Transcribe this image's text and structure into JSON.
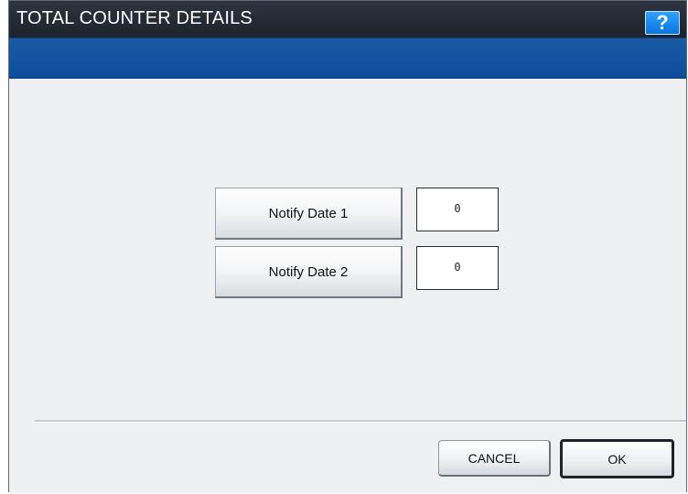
{
  "window": {
    "title": "TOTAL COUNTER DETAILS",
    "help_label": "?"
  },
  "notify": {
    "items": [
      {
        "label": "Notify Date 1",
        "value": "0"
      },
      {
        "label": "Notify Date 2",
        "value": "0"
      }
    ]
  },
  "footer": {
    "cancel_label": "CANCEL",
    "ok_label": "OK"
  },
  "colors": {
    "title_bar": "#1d232c",
    "subheader": "#0b4e9b",
    "content_bg": "#eef0f2",
    "help_button": "#0b74df"
  }
}
